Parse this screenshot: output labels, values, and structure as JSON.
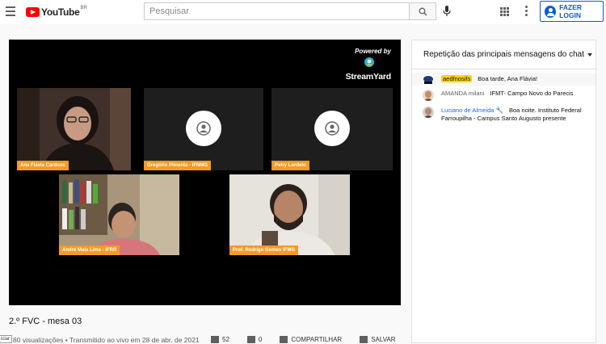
{
  "header": {
    "logo_text": "YouTube",
    "logo_country": "BR",
    "search_placeholder": "Pesquisar",
    "login_label": "FAZER LOGIN"
  },
  "video": {
    "powered_by": "Powered by",
    "brand": "StreamYard",
    "participants": [
      {
        "name": "Ana Flávia Cardozo",
        "has_camera": true
      },
      {
        "name": "Gregório Pimenta - IFNMG",
        "has_camera": false
      },
      {
        "name": "Petry Lordelo",
        "has_camera": false
      },
      {
        "name": "André Maia Lima - IFRR",
        "has_camera": true
      },
      {
        "name": "Prof. Rodrigo Gomes IFMG",
        "has_camera": true
      }
    ]
  },
  "info": {
    "title": "2.º FVC - mesa 03",
    "meta": "80 visualizações • Transmitido ao vivo em 28 de abr. de 2021",
    "start_tag": "iciar",
    "likes": "52",
    "dislikes": "0",
    "share_label": "COMPARTILHAR",
    "save_label": "SALVAR"
  },
  "chat": {
    "header": "Repetição das principais mensagens do chat",
    "messages": [
      {
        "author": "aedfnosifs",
        "text": "Boa tarde, Ana Flávia!"
      },
      {
        "author": "AMANDA milani",
        "text": "IFMT- Campo Novo do Parecis"
      },
      {
        "author": "Luciano de Almeida 🔧",
        "text": "Boa noite. Instituto Federal Farroupilha - Campus Santo Augusto presente"
      }
    ]
  },
  "colors": {
    "brand_red": "#ff0000",
    "link_blue": "#065fd4",
    "label_orange": "#f59a23",
    "badge_yellow": "#ffd600"
  }
}
